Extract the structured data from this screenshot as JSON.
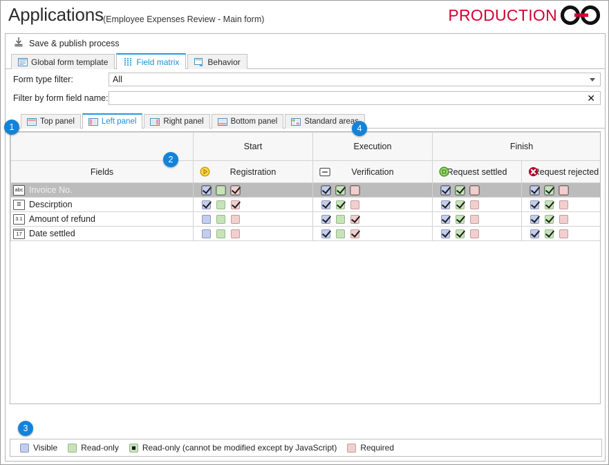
{
  "header": {
    "title": "Applications",
    "subtitle": "(Employee Expenses Review - Main form)",
    "brand": "PRODUCTION",
    "brand_color": "#d20032",
    "logo_icon": "chain-link-icon"
  },
  "toolbar": {
    "save_publish_label": "Save & publish process",
    "save_publish_icon": "save-publish-icon"
  },
  "tabs": [
    {
      "label": "Global form template",
      "icon": "form-template-icon",
      "active": false
    },
    {
      "label": "Field matrix",
      "icon": "field-matrix-icon",
      "active": true
    },
    {
      "label": "Behavior",
      "icon": "behavior-icon",
      "active": false
    }
  ],
  "filters": {
    "form_type": {
      "label": "Form type filter:",
      "value": "All",
      "placeholder": "",
      "dropdown_icon": "chevron-down-icon"
    },
    "field_name": {
      "label": "Filter by form field name:",
      "value": "",
      "placeholder": "",
      "clear_icon": "close-icon",
      "clear_glyph": "✕"
    }
  },
  "panel_tabs": [
    {
      "label": "Top panel",
      "icon": "top-panel-icon",
      "active": false
    },
    {
      "label": "Left panel",
      "icon": "left-panel-icon",
      "active": true
    },
    {
      "label": "Right panel",
      "icon": "right-panel-icon",
      "active": false
    },
    {
      "label": "Bottom panel",
      "icon": "bottom-panel-icon",
      "active": false
    },
    {
      "label": "Standard areas",
      "icon": "standard-areas-icon",
      "active": false
    }
  ],
  "matrix": {
    "fields_header": "Fields",
    "groups": [
      {
        "label": "Start",
        "span": 1
      },
      {
        "label": "Execution",
        "span": 1
      },
      {
        "label": "Finish",
        "span": 2
      }
    ],
    "columns": [
      {
        "label": "Registration",
        "icon": "start-step-icon",
        "icon_color": "#f0b400"
      },
      {
        "label": "Verification",
        "icon": "task-step-icon",
        "icon_color": "#7d7d7d"
      },
      {
        "label": "Request settled",
        "icon": "finish-ok-icon",
        "icon_color": "#5aaa22"
      },
      {
        "label": "Request rejected",
        "icon": "finish-rejected-icon",
        "icon_color": "#b5072c"
      }
    ],
    "rows": [
      {
        "name": "Invoice No.",
        "type_icon": "text-field-icon",
        "type_glyph": "abc",
        "selected": true,
        "cells": [
          {
            "visible": true,
            "readonly": false,
            "required": true
          },
          {
            "visible": true,
            "readonly": true,
            "required": false
          },
          {
            "visible": true,
            "readonly": true,
            "required": false
          },
          {
            "visible": true,
            "readonly": true,
            "required": false
          }
        ]
      },
      {
        "name": "Descirption",
        "type_icon": "multiline-field-icon",
        "type_glyph": "≡",
        "selected": false,
        "cells": [
          {
            "visible": true,
            "readonly": false,
            "required": true
          },
          {
            "visible": true,
            "readonly": true,
            "required": false
          },
          {
            "visible": true,
            "readonly": true,
            "required": false
          },
          {
            "visible": true,
            "readonly": true,
            "required": false
          }
        ]
      },
      {
        "name": "Amount of refund",
        "type_icon": "number-field-icon",
        "type_glyph": "3.1",
        "selected": false,
        "cells": [
          {
            "visible": false,
            "readonly": false,
            "required": false
          },
          {
            "visible": true,
            "readonly": false,
            "required": true
          },
          {
            "visible": true,
            "readonly": true,
            "required": false
          },
          {
            "visible": true,
            "readonly": true,
            "required": false
          }
        ]
      },
      {
        "name": "Date settled",
        "type_icon": "date-field-icon",
        "type_glyph": "17",
        "selected": false,
        "cells": [
          {
            "visible": false,
            "readonly": false,
            "required": false
          },
          {
            "visible": true,
            "readonly": false,
            "required": true
          },
          {
            "visible": true,
            "readonly": true,
            "required": false
          },
          {
            "visible": true,
            "readonly": true,
            "required": false
          }
        ]
      }
    ]
  },
  "legend": [
    {
      "label": "Visible",
      "kind": "visible",
      "dot": false
    },
    {
      "label": "Read-only",
      "kind": "readonly",
      "dot": false
    },
    {
      "label": "Read-only (cannot be modified except by JavaScript)",
      "kind": "readonly",
      "dot": true
    },
    {
      "label": "Required",
      "kind": "required",
      "dot": false
    }
  ],
  "callouts": [
    {
      "n": "1"
    },
    {
      "n": "2"
    },
    {
      "n": "3"
    },
    {
      "n": "4"
    }
  ],
  "colors": {
    "accent": "#1b9ae0",
    "badge": "#1383d8",
    "visible": "#c3cdef",
    "readonly": "#c6e4b8",
    "required": "#f2cfcf",
    "selection": "#bcbcbc"
  }
}
